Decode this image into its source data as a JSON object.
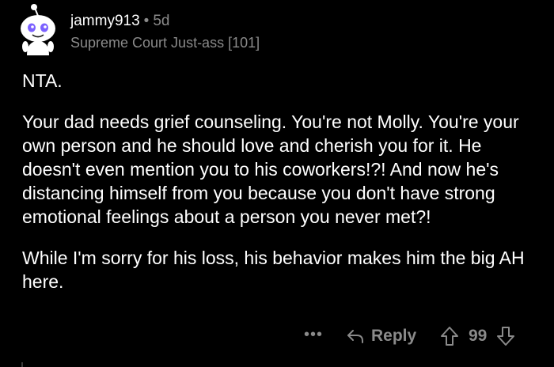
{
  "comment": {
    "author": "jammy913",
    "separator": "•",
    "age": "5d",
    "flair": "Supreme Court Just-ass [101]",
    "paragraphs": [
      "NTA.",
      "Your dad needs grief counseling.  You're not Molly.  You're your own person and he should love and cherish you for it.  He doesn't even mention you to his coworkers!?!  And now he's distancing himself from you because you don't have strong emotional feelings about a person you never met?!",
      "While I'm sorry for his loss, his behavior makes him the big AH here."
    ]
  },
  "actions": {
    "more_label": "•••",
    "reply_label": "Reply",
    "vote_count": "99"
  },
  "icons": {
    "avatar": "snoo-avatar-icon",
    "reply": "reply-arrow-icon",
    "upvote": "upvote-arrow-icon",
    "downvote": "downvote-arrow-icon",
    "more": "more-options-icon"
  },
  "colors": {
    "background": "#000000",
    "text": "#ffffff",
    "muted": "#8a8a8a",
    "avatar_eyes": "#7b61ff"
  }
}
